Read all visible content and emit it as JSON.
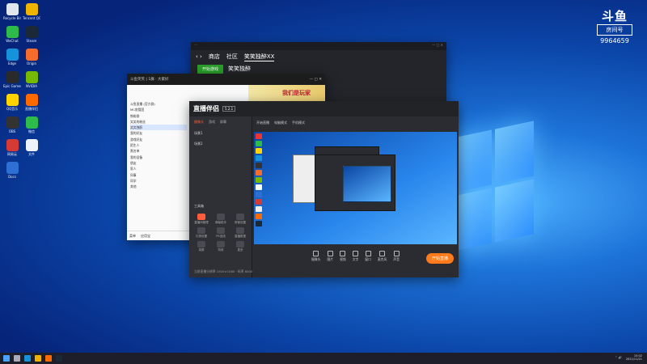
{
  "desktop": {
    "icons": [
      {
        "label": "Recycle Bin",
        "color": "#dfe6ee"
      },
      {
        "label": "Tencent QQ",
        "color": "#f0b400"
      },
      {
        "label": "WeChat",
        "color": "#2dbb49"
      },
      {
        "label": "Steam",
        "color": "#1b2838"
      },
      {
        "label": "Edge",
        "color": "#1592d9"
      },
      {
        "label": "Origin",
        "color": "#f56c2d"
      },
      {
        "label": "Epic Games",
        "color": "#2a2a2a"
      },
      {
        "label": "NVIDIA",
        "color": "#76b900"
      },
      {
        "label": "QQ音乐",
        "color": "#ffd400"
      },
      {
        "label": "直播伴侣",
        "color": "#ff6a00"
      },
      {
        "label": "OBS",
        "color": "#333"
      },
      {
        "label": "微信",
        "color": "#2dbb49"
      },
      {
        "label": "网易云",
        "color": "#d53a35"
      },
      {
        "label": "文件",
        "color": "#eef3fb"
      },
      {
        "label": "Docs",
        "color": "#2d6fd3"
      }
    ]
  },
  "watermark": {
    "brand": "斗鱼",
    "badge": "房间号",
    "room_id": "9964659"
  },
  "game_window": {
    "tabs": [
      "商店",
      "社区",
      "笑笑独醉XX"
    ],
    "start": "开始游戏",
    "user": "笑笑独醉"
  },
  "qq_window": {
    "title": "斗鱼笑笑 | 1群 · 大家好",
    "banner_text": "我们是玩家",
    "tree": [
      "斗鱼直播 (官方群)",
      "MC房管团",
      "铁粉群",
      "笑笑的粉丝",
      "笑笑独醉",
      "我的好友",
      "游戏好友",
      "陌生人",
      "黑名单",
      "我的设备",
      "朋友",
      "家人",
      "同事",
      "同学",
      "其他"
    ],
    "footer_a": "菜单",
    "footer_b": "应用宝"
  },
  "stream_window": {
    "logo": "直播伴侣",
    "version": "5.2.1",
    "tabs": [
      "摄像头",
      "游戏",
      "屏幕"
    ],
    "scenes": [
      "场景1",
      "场景2"
    ],
    "tools_label": "工具箱",
    "tools": [
      "直播间管理",
      "弹幕助手",
      "房管设置",
      "礼物设置",
      "PK连线",
      "直播数据",
      "录屏",
      "特效",
      "更多"
    ],
    "head": [
      "开始直播",
      "电脑模式",
      "手机模式"
    ],
    "bottom": [
      "摄像头",
      "图片",
      "视频",
      "文字",
      "窗口",
      "麦克风",
      "声音"
    ],
    "live_btn": "开始直播",
    "footer": "当前直播分辨率 1920×1080 · 码率 6000"
  },
  "taskbar": {
    "time": "15:02",
    "date": "2021/11/21"
  }
}
